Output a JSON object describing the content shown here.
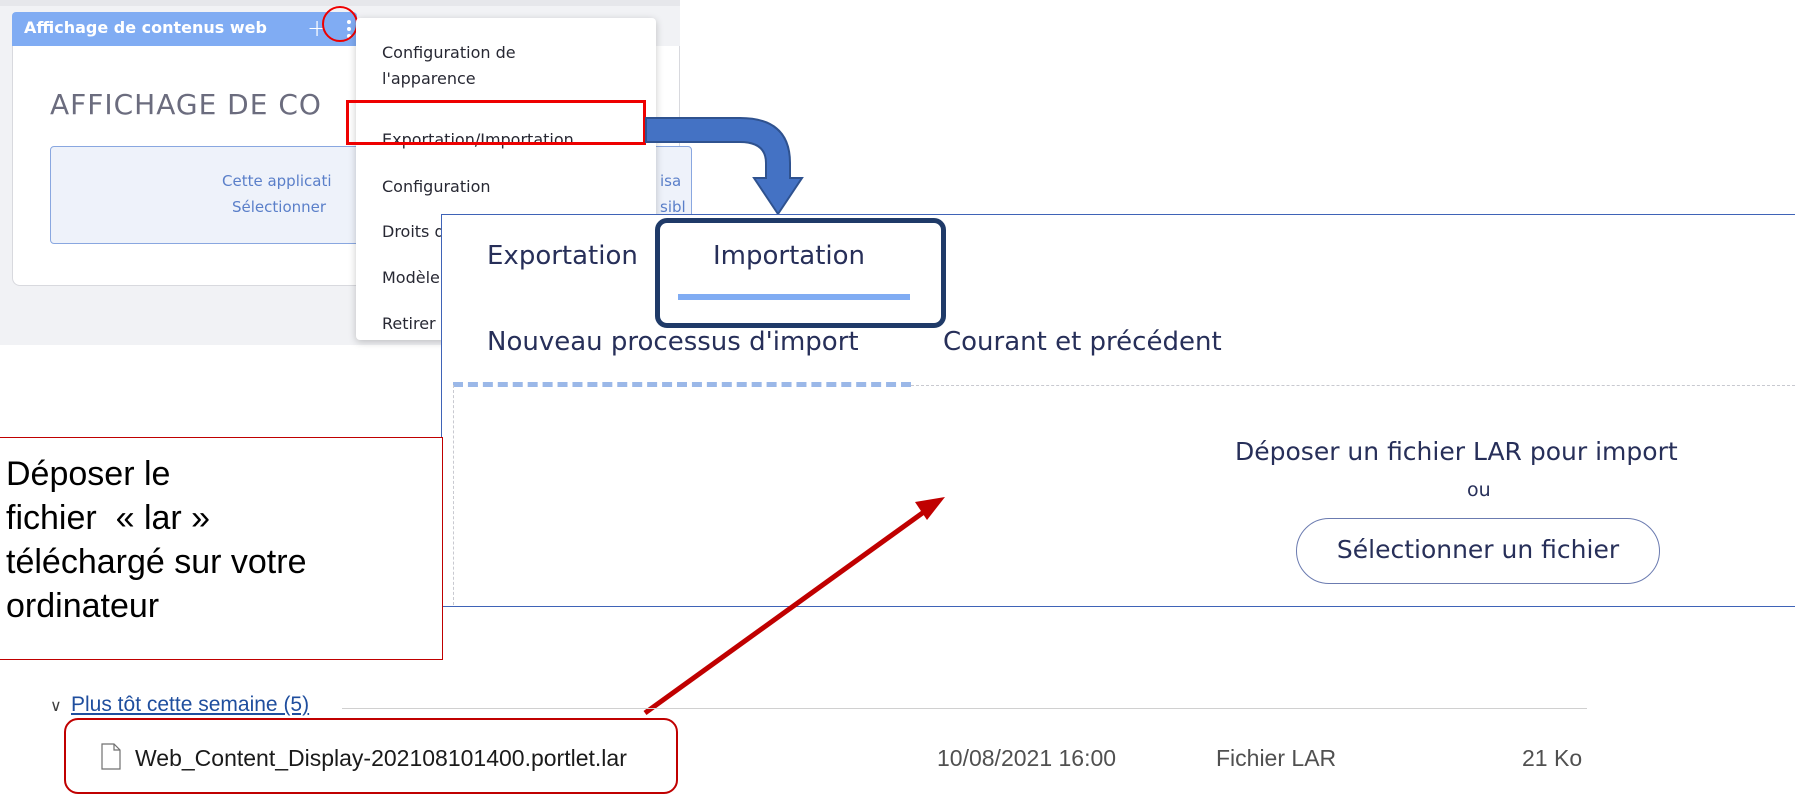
{
  "portlet": {
    "header_title": "Affichage de contenus web",
    "add_symbol": "+",
    "heading": "AFFICHAGE DE CO",
    "info_line1": "Cette applicati",
    "info_line2": "Sélectionner",
    "info_right1": "isa",
    "info_right2": "sibl"
  },
  "menu": {
    "items": [
      "Configuration de l'apparence",
      "Exportation/Importation",
      "Configuration",
      "Droits d'accès",
      "Modèle",
      "Retirer"
    ],
    "visible_labels": {
      "appearance": "Configuration de l'apparence",
      "export_import": "Exportation/Importation",
      "config": "Configuration",
      "droits": "Droits d'accès",
      "modele": "Modèle",
      "retirer": "Retirer"
    }
  },
  "panel": {
    "tabs": [
      "Exportation",
      "Importation"
    ],
    "active_tab": "Importation",
    "subtabs": [
      "Nouveau processus d'import",
      "Courant et précédent"
    ],
    "drop_text": "Déposer un fichier LAR pour import",
    "or_text": "ou",
    "select_button": "Sélectionner un fichier"
  },
  "annotation": {
    "text_lines": [
      "Déposer le",
      "fichier  « lar »",
      "téléchargé sur votre",
      "ordinateur"
    ]
  },
  "explorer": {
    "group_label": "Plus tôt cette semaine (5)",
    "file": {
      "name": "Web_Content_Display-202108101400.portlet.lar",
      "date": "10/08/2021 16:00",
      "type": "Fichier LAR",
      "size": "21 Ko"
    }
  },
  "colors": {
    "highlight_red": "#ee0000",
    "note_border": "#c00000",
    "panel_border": "#3f63b7",
    "tab_frame": "#1f3a68",
    "tab_underline": "#80acf3",
    "header_blue": "#80acf3"
  }
}
